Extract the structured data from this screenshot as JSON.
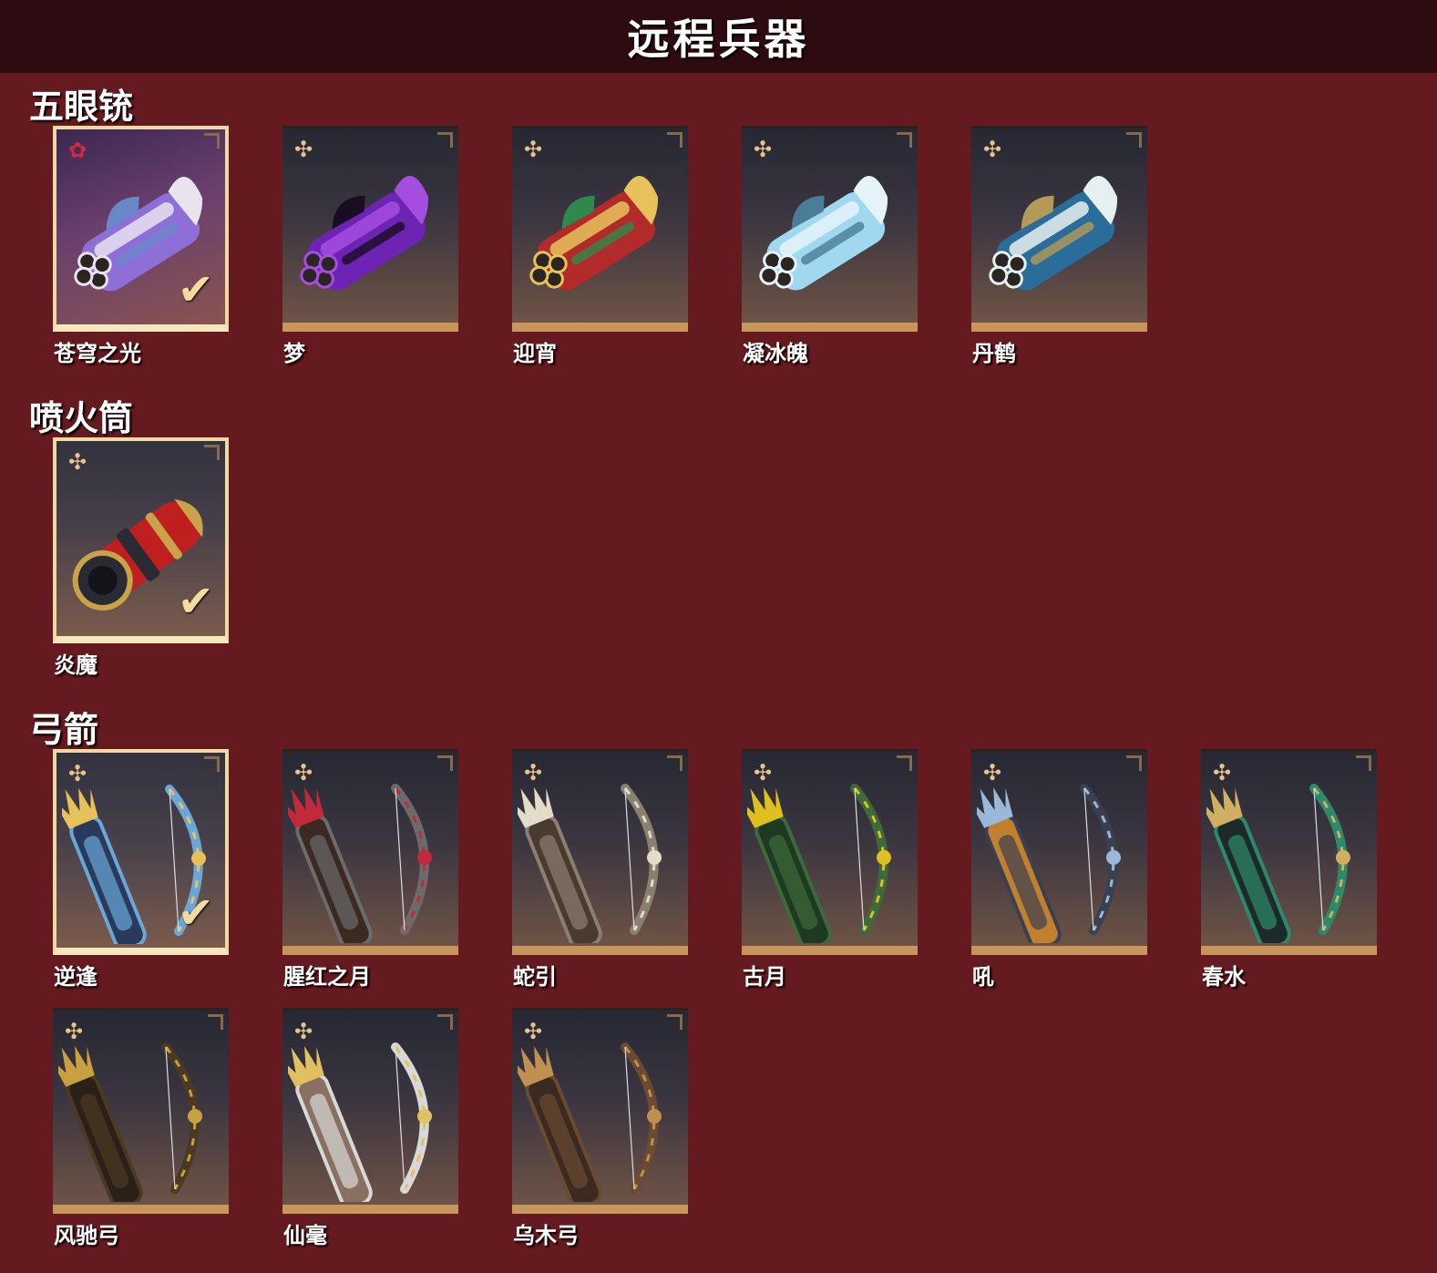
{
  "header": {
    "title": "远程兵器"
  },
  "sections": [
    {
      "title": "五眼铳",
      "items": [
        {
          "name": "苍穹之光",
          "icon": "five-eyed-gun-icon",
          "rarity": "red-flower-icon",
          "equipped": true
        },
        {
          "name": "梦",
          "icon": "five-eyed-gun-icon",
          "rarity": "gold-flower-icon",
          "equipped": false
        },
        {
          "name": "迎宵",
          "icon": "five-eyed-gun-icon",
          "rarity": "gold-flower-icon",
          "equipped": false
        },
        {
          "name": "凝冰魄",
          "icon": "five-eyed-gun-icon",
          "rarity": "gold-flower-icon",
          "equipped": false
        },
        {
          "name": "丹鹤",
          "icon": "five-eyed-gun-icon",
          "rarity": "gold-flower-icon",
          "equipped": false
        }
      ]
    },
    {
      "title": "喷火筒",
      "items": [
        {
          "name": "炎魔",
          "icon": "flamethrower-icon",
          "rarity": "gold-flower-icon",
          "equipped": true
        }
      ]
    },
    {
      "title": "弓箭",
      "items": [
        {
          "name": "逆逢",
          "icon": "bow-quiver-icon",
          "rarity": "gold-flower-icon",
          "equipped": true
        },
        {
          "name": "腥红之月",
          "icon": "bow-quiver-icon",
          "rarity": "gold-flower-icon",
          "equipped": false
        },
        {
          "name": "蛇引",
          "icon": "bow-quiver-icon",
          "rarity": "gold-flower-icon",
          "equipped": false
        },
        {
          "name": "古月",
          "icon": "bow-quiver-icon",
          "rarity": "gold-flower-icon",
          "equipped": false
        },
        {
          "name": "吼",
          "icon": "bow-quiver-icon",
          "rarity": "gold-flower-icon",
          "equipped": false
        },
        {
          "name": "春水",
          "icon": "bow-quiver-icon",
          "rarity": "gold-flower-icon",
          "equipped": false
        },
        {
          "name": "风驰弓",
          "icon": "bow-quiver-icon",
          "rarity": "gold-flower-icon",
          "equipped": false
        },
        {
          "name": "仙毫",
          "icon": "bow-quiver-icon",
          "rarity": "gold-flower-icon",
          "equipped": false
        },
        {
          "name": "乌木弓",
          "icon": "bow-quiver-icon",
          "rarity": "gold-flower-icon",
          "equipped": false
        }
      ]
    }
  ],
  "colors": {
    "background": "#651a1f",
    "header": "#2e0b10",
    "card_trim": "#c8955a",
    "gold": "#e8c48a",
    "red_rarity": "#d6283a",
    "gun_palettes": [
      [
        "#8e6fd8",
        "#e9e3f0",
        "#6a88c8"
      ],
      [
        "#6d23b3",
        "#a54de0",
        "#1a0c22"
      ],
      [
        "#b32a2a",
        "#e7c25a",
        "#2e8a4a"
      ],
      [
        "#9fd8ef",
        "#e6f4fa",
        "#4a7d96"
      ],
      [
        "#2a6d9a",
        "#e7f0f0",
        "#b39a56"
      ]
    ],
    "flame_palette": [
      "#c01f1f",
      "#c9a24a",
      "#2a2a35"
    ],
    "bow_palettes": [
      [
        "#6aa6d8",
        "#e7c25a",
        "#2a3a5a"
      ],
      [
        "#6b6b6b",
        "#c22a3a",
        "#3a2a22"
      ],
      [
        "#8a8070",
        "#e4dcc8",
        "#4a3a30"
      ],
      [
        "#3e6a3a",
        "#e0c020",
        "#1e3a22"
      ],
      [
        "#3a4050",
        "#9ab8d8",
        "#c08030"
      ],
      [
        "#2c8a6a",
        "#d0b060",
        "#1e2a2a"
      ],
      [
        "#4a3a22",
        "#c8a040",
        "#2a2018"
      ],
      [
        "#d8d8d8",
        "#e0c060",
        "#8a7060"
      ],
      [
        "#6a4a30",
        "#c09050",
        "#3a2a20"
      ]
    ]
  }
}
